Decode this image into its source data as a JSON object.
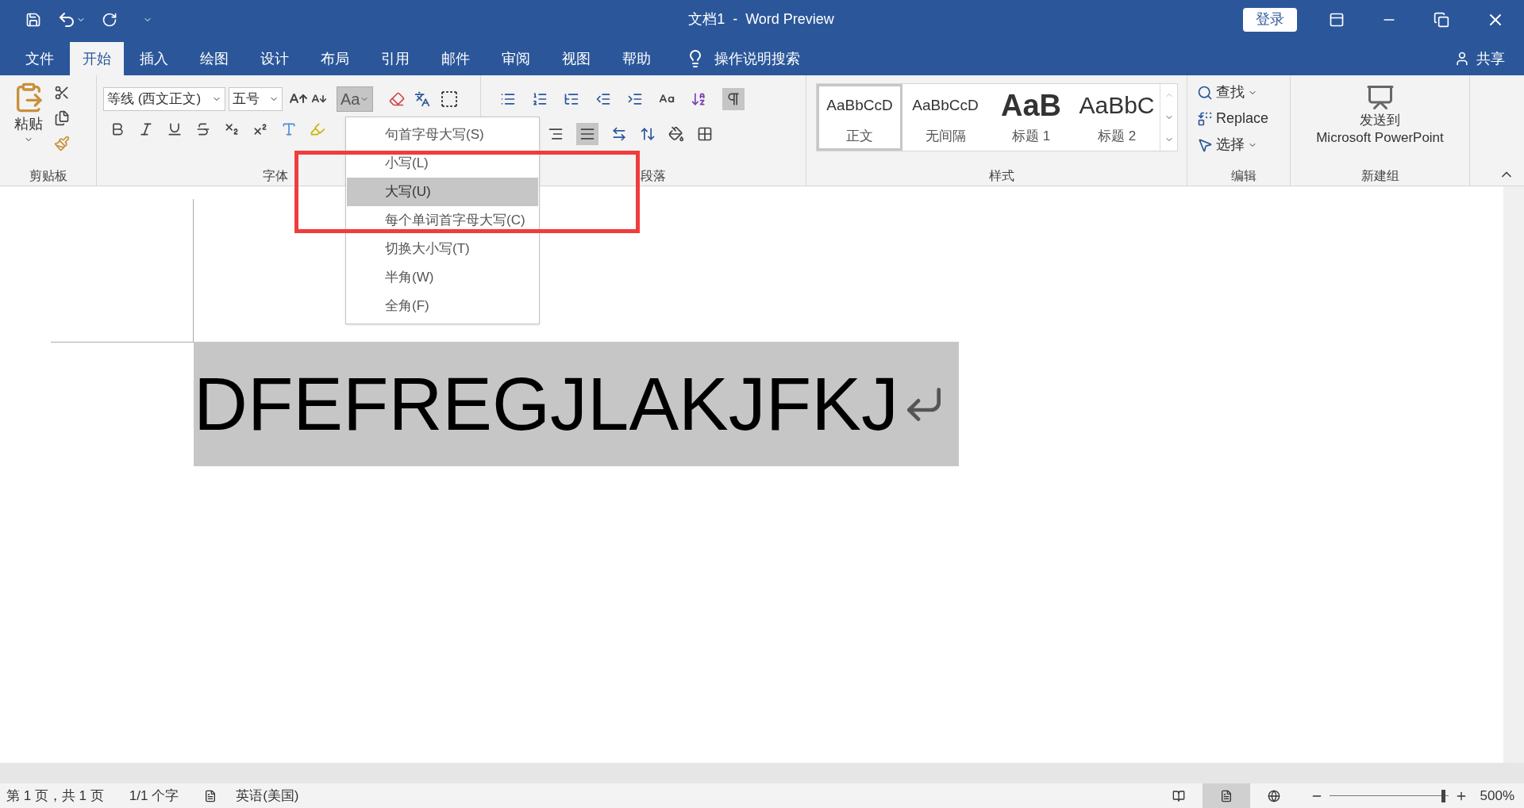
{
  "title_bar": {
    "title": "文档1  -  Word Preview",
    "login_button": "登录"
  },
  "menu_tabs": [
    {
      "label": "文件",
      "selected": false
    },
    {
      "label": "开始",
      "selected": true
    },
    {
      "label": "插入",
      "selected": false
    },
    {
      "label": "绘图",
      "selected": false
    },
    {
      "label": "设计",
      "selected": false
    },
    {
      "label": "布局",
      "selected": false
    },
    {
      "label": "引用",
      "selected": false
    },
    {
      "label": "邮件",
      "selected": false
    },
    {
      "label": "审阅",
      "selected": false
    },
    {
      "label": "视图",
      "selected": false
    },
    {
      "label": "帮助",
      "selected": false
    }
  ],
  "tell_me": "操作说明搜索",
  "share": "共享",
  "ribbon": {
    "clipboard": {
      "label": "剪贴板",
      "paste": "粘贴"
    },
    "font": {
      "label": "字体",
      "font_name": "等线 (西文正文)",
      "font_size": "五号",
      "change_case": {
        "label": "Aa",
        "expanded": true
      }
    },
    "paragraph": {
      "label": "段落"
    },
    "styles": {
      "label": "样式",
      "items": [
        {
          "preview": "AaBbCcD",
          "name": "正文",
          "kind": "normal",
          "selected": true
        },
        {
          "preview": "AaBbCcD",
          "name": "无间隔",
          "kind": "normal",
          "selected": false
        },
        {
          "preview": "AaB",
          "name": "标题 1",
          "kind": "heading1",
          "selected": false
        },
        {
          "preview": "AaBbC",
          "name": "标题 2",
          "kind": "heading2",
          "selected": false
        }
      ]
    },
    "editing": {
      "label": "编辑",
      "items": [
        {
          "label": "查找",
          "kind": "find"
        },
        {
          "label": "Replace",
          "kind": "replace"
        },
        {
          "label": "选择",
          "kind": "select"
        }
      ]
    },
    "new_group": {
      "label": "新建组",
      "button_lines": [
        "发送到",
        "Microsoft PowerPoint"
      ]
    }
  },
  "change_case_menu": [
    {
      "label": "句首字母大写(S)",
      "selected": false
    },
    {
      "label": "小写(L)",
      "selected": false
    },
    {
      "label": "大写(U)",
      "selected": true
    },
    {
      "label": "每个单词首字母大写(C)",
      "selected": false
    },
    {
      "label": "切换大小写(T)",
      "selected": false
    },
    {
      "label": "半角(W)",
      "selected": false
    },
    {
      "label": "全角(F)",
      "selected": false
    }
  ],
  "document": {
    "text": "DFEFREGJLAKJFKJ",
    "selected": true
  },
  "status_bar": {
    "page": "第 1 页，共 1 页",
    "words": "1/1 个字",
    "language": "英语(美国)",
    "views": [
      {
        "kind": "read",
        "selected": false
      },
      {
        "kind": "print",
        "selected": true
      },
      {
        "kind": "web",
        "selected": false
      }
    ],
    "zoom": {
      "level": 0.96,
      "label": "500%"
    }
  }
}
